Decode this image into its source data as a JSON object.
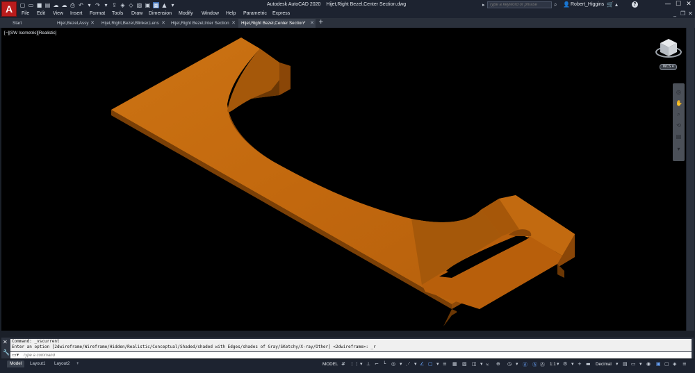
{
  "app": {
    "logo_letter": "A",
    "title": "Autodesk AutoCAD 2020",
    "document": "Hijet,Right Bezel,Center Section.dwg"
  },
  "quick_access": [
    {
      "icon": "new-icon",
      "glyph": "▢"
    },
    {
      "icon": "open-icon",
      "glyph": "▭"
    },
    {
      "icon": "save-icon",
      "glyph": "■"
    },
    {
      "icon": "save-as-icon",
      "glyph": "▤"
    },
    {
      "icon": "cloud-open-icon",
      "glyph": "☁"
    },
    {
      "icon": "cloud-save-icon",
      "glyph": "☁"
    },
    {
      "icon": "print-icon",
      "glyph": "⎙"
    },
    {
      "icon": "undo-icon",
      "glyph": "↶"
    },
    {
      "icon": "undo-dropdown-icon",
      "glyph": "▾"
    },
    {
      "icon": "redo-icon",
      "glyph": "↷"
    },
    {
      "icon": "redo-dropdown-icon",
      "glyph": "▾"
    },
    {
      "icon": "share-drawing-icon",
      "glyph": "⇪"
    },
    {
      "icon": "layer-icon",
      "glyph": "◈"
    },
    {
      "icon": "workspace-icon",
      "glyph": "◇"
    },
    {
      "icon": "match-properties-icon",
      "glyph": "▧"
    },
    {
      "icon": "plot-icon",
      "glyph": "▣"
    },
    {
      "icon": "workspace-switch-icon",
      "glyph": "▩"
    },
    {
      "icon": "visual-style-icon",
      "glyph": "▲"
    },
    {
      "icon": "customize-icon",
      "glyph": "▾"
    }
  ],
  "search": {
    "placeholder": "Type a keyword or phrase"
  },
  "user": {
    "name": "Robert_Higgins"
  },
  "menu": [
    "File",
    "Edit",
    "View",
    "Insert",
    "Format",
    "Tools",
    "Draw",
    "Dimension",
    "Modify",
    "Window",
    "Help",
    "Parametric",
    "Express"
  ],
  "tabs": [
    {
      "label": "Start",
      "closable": false,
      "active": false
    },
    {
      "label": "Hijet,Bezel,Assy",
      "closable": true,
      "active": false
    },
    {
      "label": "Hijet,Right,Bezel,Blinker,Lens",
      "closable": true,
      "active": false
    },
    {
      "label": "Hijet,Right Bezel,Inter Section",
      "closable": true,
      "active": false
    },
    {
      "label": "Hijet,Right Bezel,Center Section*",
      "closable": true,
      "active": true
    }
  ],
  "new_tab_label": "+",
  "viewport": {
    "controls_label": "[−][SW Isometric][Realistic]",
    "wcs_label": "WCS ▾",
    "background": "#000000",
    "model_color": "#c2680e",
    "model_shadow": "#6b3704"
  },
  "command": {
    "history": [
      "Command: _vscurrent",
      "Enter an option [2dwireframe/Wireframe/Hidden/Realistic/Conceptual/Shaded/shaded with Edges/shades of Gray/SKetchy/X-ray/Other] <2dwireframe>: _r"
    ],
    "placeholder": "Type a command"
  },
  "layout_tabs": [
    {
      "label": "Model",
      "active": true
    },
    {
      "label": "Layout1",
      "active": false
    },
    {
      "label": "Layout2",
      "active": false
    }
  ],
  "add_layout_label": "+",
  "status": {
    "model_label": "MODEL",
    "scale_label": "1:1",
    "units_label": "Decimal"
  },
  "colors": {
    "titlebar": "#1d2330",
    "tabbar": "#2a303b",
    "active_tab": "#3a414d",
    "accent": "#3f6fb5",
    "autocad_red": "#b91c1c"
  }
}
